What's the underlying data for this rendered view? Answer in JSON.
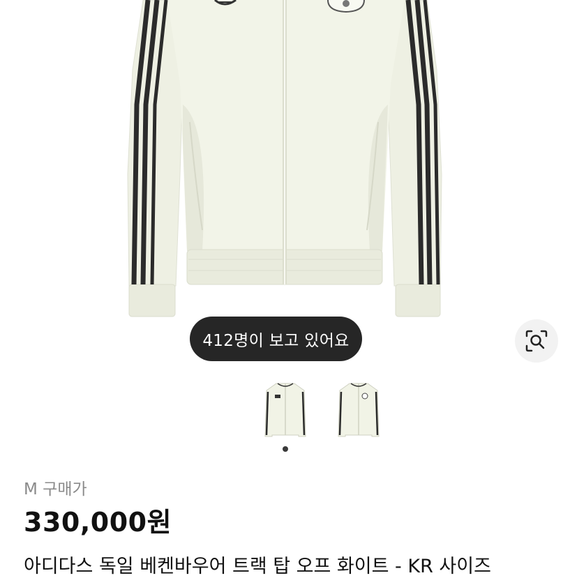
{
  "product": {
    "viewers_text": "412명이 보고 있어요",
    "size_label": "M 구매가",
    "price": "330,000원",
    "title": "아디다스 독일 베켄바우어 트랙 탑 오프 화이트 - KR 사이즈"
  },
  "gallery": {
    "thumbnails": [
      "jacket-front-thumbnail",
      "jacket-front-thumbnail"
    ],
    "page_count": 2,
    "active_page": 1
  },
  "icons": {
    "lens": "image-search-icon"
  },
  "colors": {
    "jacket": "#f1f3e6",
    "stripes": "#2b2b2b",
    "badge_bg": "#262626",
    "price_text": "#111111"
  }
}
